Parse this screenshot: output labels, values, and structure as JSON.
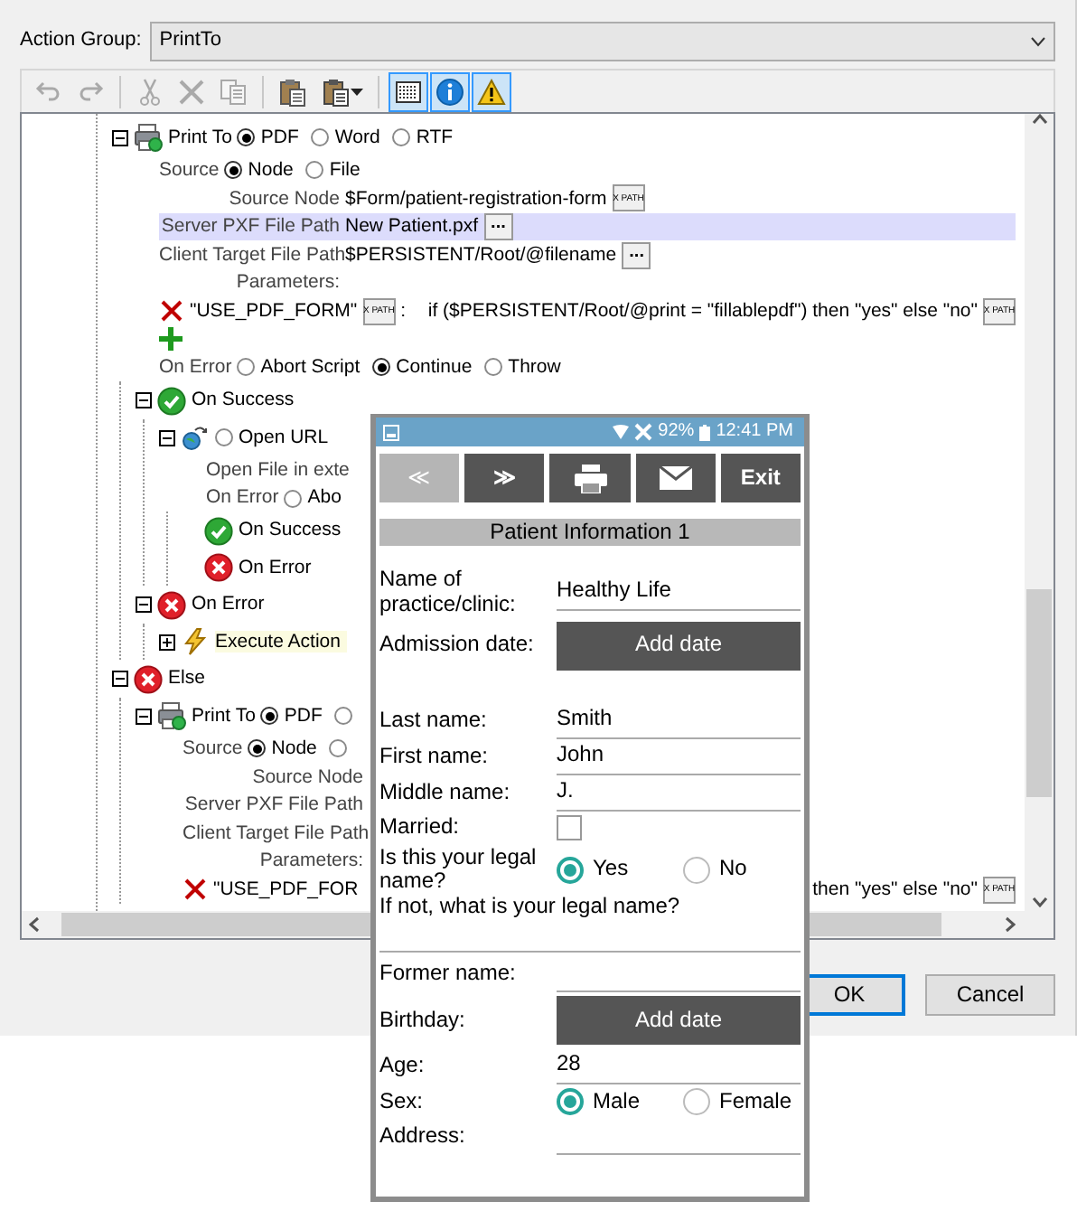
{
  "action_group": {
    "label": "Action Group:",
    "value": "PrintTo"
  },
  "toolbar": [
    {
      "kind": "undo",
      "disabled": true
    },
    {
      "kind": "redo",
      "disabled": true
    },
    {
      "kind": "separator"
    },
    {
      "kind": "cut",
      "disabled": true
    },
    {
      "kind": "delete",
      "disabled": true
    },
    {
      "kind": "copy",
      "disabled": true
    },
    {
      "kind": "separator"
    },
    {
      "kind": "paste",
      "disabled": false
    },
    {
      "kind": "paste_special",
      "disabled": false
    },
    {
      "kind": "separator"
    },
    {
      "kind": "grid",
      "selected": true
    },
    {
      "kind": "info",
      "selected": true
    },
    {
      "kind": "warning",
      "selected": true
    }
  ],
  "tree": [
    {
      "kind": "print",
      "expanded": true,
      "label": "Print To",
      "options": [
        {
          "label": "PDF",
          "selected": true
        },
        {
          "label": "Word",
          "selected": false
        },
        {
          "label": "RTF",
          "selected": false
        }
      ],
      "lines": [
        {
          "kind": "radios",
          "label": "Source",
          "options": [
            {
              "label": "Node",
              "selected": true
            },
            {
              "label": "File",
              "selected": false
            }
          ]
        },
        {
          "kind": "field",
          "label": "Source Node",
          "value": "$Form/patient-registration-form",
          "button": "X PATH",
          "highlighted": false
        },
        {
          "kind": "field",
          "label": "Server PXF File Path",
          "value": "New Patient.pxf",
          "button": "...",
          "highlighted": true
        },
        {
          "kind": "field",
          "label": "Client Target File Path",
          "value": "$PERSISTENT/Root/@filename",
          "button": "...",
          "highlighted": false
        },
        {
          "kind": "heading",
          "label": "Parameters:"
        },
        {
          "kind": "param",
          "name": "\"USE_PDF_FORM\"",
          "button": "X PATH",
          "separator": ":",
          "value": "if ($PERSISTENT/Root/@print = \"fillablepdf\") then \"yes\" else \"no\"",
          "value_button": "X PATH"
        },
        {
          "kind": "add"
        },
        {
          "kind": "radios",
          "label": "On Error",
          "options": [
            {
              "label": "Abort Script",
              "selected": false
            },
            {
              "label": "Continue",
              "selected": true
            },
            {
              "label": "Throw",
              "selected": false
            }
          ]
        }
      ],
      "children": [
        {
          "kind": "success",
          "expanded": true,
          "label": "On Success",
          "children": [
            {
              "kind": "open_url",
              "expanded": true,
              "options": [
                {
                  "label": "Open URL",
                  "selected": false
                }
              ],
              "lines": [
                {
                  "kind": "text",
                  "label": "Open File in exte"
                },
                {
                  "kind": "radios",
                  "label": "On Error",
                  "options": [
                    {
                      "label": "Abo",
                      "selected": false
                    }
                  ]
                }
              ],
              "children": [
                {
                  "kind": "success",
                  "label": "On Success"
                },
                {
                  "kind": "error",
                  "label": "On Error"
                }
              ]
            }
          ]
        },
        {
          "kind": "error",
          "expanded": true,
          "label": "On Error",
          "children": [
            {
              "kind": "action",
              "expanded": false,
              "label": "Execute Action",
              "highlighted": true
            }
          ]
        }
      ]
    },
    {
      "kind": "else",
      "expanded": true,
      "label": "Else",
      "children": [
        {
          "kind": "print",
          "expanded": true,
          "label": "Print To",
          "options": [
            {
              "label": "PDF",
              "selected": true
            },
            {
              "selected": false
            }
          ],
          "lines": [
            {
              "kind": "radios",
              "label": "Source",
              "options": [
                {
                  "label": "Node",
                  "selected": true
                },
                {
                  "selected": false
                }
              ]
            },
            {
              "kind": "field",
              "label": "Source Node",
              "highlighted": false
            },
            {
              "kind": "field",
              "label": "Server PXF File Path",
              "highlighted": false
            },
            {
              "kind": "field",
              "label": "Client Target File Path",
              "highlighted": false
            },
            {
              "kind": "heading",
              "label": "Parameters:"
            },
            {
              "kind": "param",
              "name": "\"USE_PDF_FOR",
              "value": "then \"yes\" else \"no\"",
              "value_button": "X PATH"
            }
          ]
        }
      ]
    }
  ],
  "buttons": [
    {
      "label": "OK",
      "default": true
    },
    {
      "label": "Cancel",
      "default": false
    }
  ],
  "phone": {
    "status": {
      "battery": "92%",
      "time": "12:41 PM"
    },
    "buttons": [
      {
        "kind": "prev",
        "label": "≪",
        "disabled": true
      },
      {
        "kind": "next",
        "label": "≫",
        "disabled": false
      },
      {
        "kind": "print",
        "disabled": false
      },
      {
        "kind": "email",
        "disabled": false
      },
      {
        "kind": "text",
        "label": "Exit",
        "disabled": false
      }
    ],
    "section": "Patient Information 1",
    "fields": [
      {
        "kind": "text",
        "label": "Name of practice/clinic:",
        "value": "Healthy Life"
      },
      {
        "kind": "date",
        "label": "Admission date:",
        "button": "Add date"
      },
      {
        "kind": "text",
        "label": "Last name:",
        "value": "Smith",
        "section_break": true
      },
      {
        "kind": "text",
        "label": "First name:",
        "value": "John"
      },
      {
        "kind": "text",
        "label": "Middle name:",
        "value": "J."
      },
      {
        "kind": "checkbox",
        "label": "Married:",
        "checked": false
      },
      {
        "kind": "radios",
        "label": "Is this your legal name?",
        "options": [
          {
            "label": "Yes",
            "selected": true
          },
          {
            "label": "No",
            "selected": false
          }
        ]
      },
      {
        "kind": "prompt",
        "label": "If not, what is your legal name?"
      },
      {
        "kind": "text",
        "label": "Former name:"
      },
      {
        "kind": "date",
        "label": "Birthday:",
        "button": "Add date"
      },
      {
        "kind": "text",
        "label": "Age:",
        "value": "28"
      },
      {
        "kind": "radios",
        "label": "Sex:",
        "options": [
          {
            "label": "Male",
            "selected": true
          },
          {
            "label": "Female",
            "selected": false
          }
        ]
      },
      {
        "kind": "text",
        "label": "Address:"
      }
    ]
  }
}
